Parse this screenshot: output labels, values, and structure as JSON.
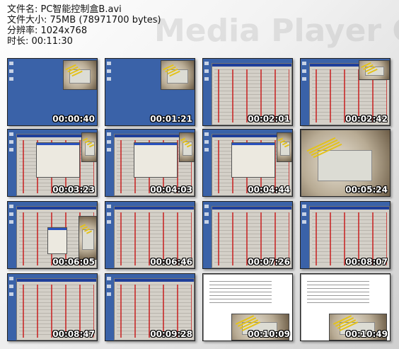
{
  "header": {
    "file_name": "文件名: PC智能控制盒B.avi",
    "file_size": "文件大小: 75MB (78971700 bytes)",
    "resolution": "分辨率: 1024x768",
    "duration": "时长: 00:11:30"
  },
  "watermark": "Media Player Classic",
  "thumbnails": [
    {
      "time": "00:00:40",
      "scene": "desktop-photo"
    },
    {
      "time": "00:01:21",
      "scene": "desktop-photo"
    },
    {
      "time": "00:02:01",
      "scene": "app-window"
    },
    {
      "time": "00:02:42",
      "scene": "app-window-photo"
    },
    {
      "time": "00:03:23",
      "scene": "app-window-dialog"
    },
    {
      "time": "00:04:03",
      "scene": "app-window-dialog"
    },
    {
      "time": "00:04:44",
      "scene": "app-window-dialog"
    },
    {
      "time": "00:05:24",
      "scene": "photo"
    },
    {
      "time": "00:06:05",
      "scene": "app-window-menu"
    },
    {
      "time": "00:06:46",
      "scene": "app-window"
    },
    {
      "time": "00:07:26",
      "scene": "app-window"
    },
    {
      "time": "00:08:07",
      "scene": "app-window"
    },
    {
      "time": "00:08:47",
      "scene": "app-window"
    },
    {
      "time": "00:09:28",
      "scene": "app-window"
    },
    {
      "time": "00:10:09",
      "scene": "document-photo"
    },
    {
      "time": "00:10:49",
      "scene": "document-photo"
    }
  ],
  "colors": {
    "desktop": "#3a62a8",
    "timestamp": "#ffffff",
    "relay": "#c81e1e"
  }
}
